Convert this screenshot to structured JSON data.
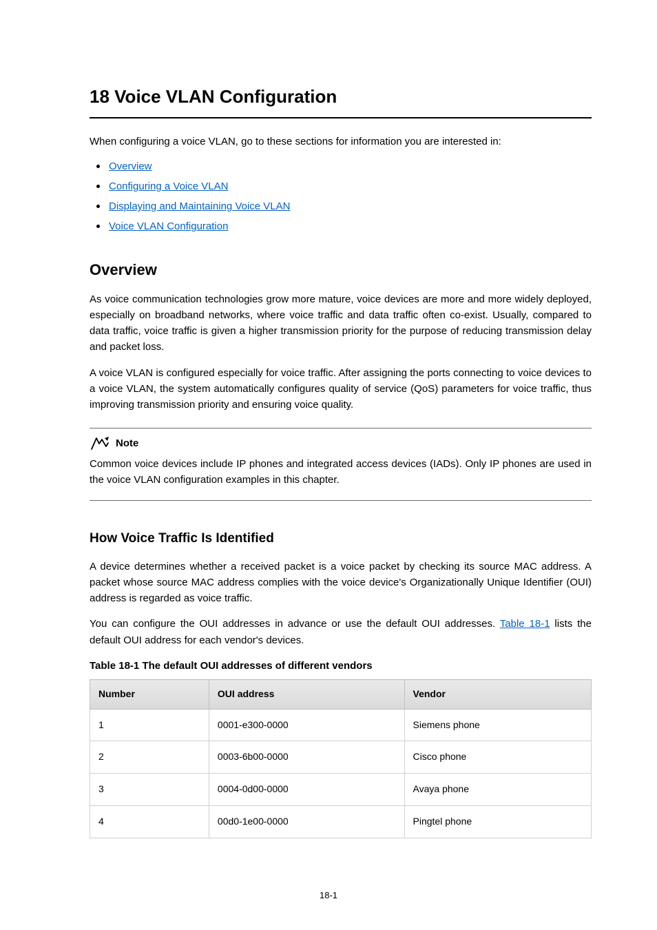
{
  "chapter": {
    "number": "18",
    "title": "Voice VLAN Configuration",
    "heading": "18  Voice VLAN Configuration"
  },
  "intro": "When configuring a voice VLAN, go to these sections for information you are interested in:",
  "toc_links": [
    "Overview",
    "Configuring a Voice VLAN",
    "Displaying and Maintaining Voice VLAN",
    "Voice VLAN Configuration"
  ],
  "overview": {
    "heading": "Overview",
    "para1": "As voice communication technologies grow more mature, voice devices are more and more widely deployed, especially on broadband networks, where voice traffic and data traffic often co-exist. Usually, compared to data traffic, voice traffic is given a higher transmission priority for the purpose of reducing transmission delay and packet loss.",
    "para2": "A voice VLAN is configured especially for voice traffic. After assigning the ports connecting to voice devices to a voice VLAN, the system automatically configures quality of service (QoS) parameters for voice traffic, thus improving transmission priority and ensuring voice quality."
  },
  "note": {
    "title": "Note",
    "body": "Common voice devices include IP phones and integrated access devices (IADs). Only IP phones are used in the voice VLAN configuration examples in this chapter."
  },
  "section": {
    "heading": "How Voice Traffic Is Identified",
    "para1": "A device determines whether a received packet is a voice packet by checking its source MAC address. A packet whose source MAC address complies with the voice device's Organizationally Unique Identifier (OUI) address is regarded as voice traffic.",
    "para2_before": "You can configure the OUI addresses in advance or use the default OUI addresses. ",
    "para2_link": "Table 18-1",
    "para2_after": " lists the default OUI address for each vendor's devices."
  },
  "table": {
    "caption": "Table 18-1 The default OUI addresses of different vendors",
    "headers": [
      "Number",
      "OUI address",
      "Vendor"
    ],
    "rows": [
      {
        "number": "1",
        "oui": "0001-e300-0000",
        "vendor": "Siemens phone"
      },
      {
        "number": "2",
        "oui": "0003-6b00-0000",
        "vendor": "Cisco phone"
      },
      {
        "number": "3",
        "oui": "0004-0d00-0000",
        "vendor": "Avaya phone"
      },
      {
        "number": "4",
        "oui": "00d0-1e00-0000",
        "vendor": "Pingtel phone"
      }
    ]
  },
  "page_number": "18-1"
}
